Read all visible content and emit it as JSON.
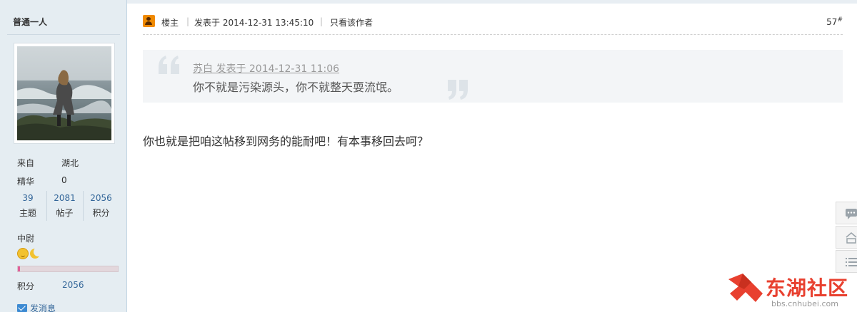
{
  "user": {
    "username": "普通一人",
    "from_label": "来自",
    "from_value": "湖北",
    "essence_label": "精华",
    "essence_value": "0",
    "stats": [
      {
        "value": "39",
        "label": "主题"
      },
      {
        "value": "2081",
        "label": "帖子"
      },
      {
        "value": "2056",
        "label": "积分"
      }
    ],
    "rank": "中尉",
    "medal_icons": [
      "sun-face-icon",
      "crescent-moon-icon"
    ],
    "level_progress_fraction": 0.02,
    "score_label": "积分",
    "score_value": "2056",
    "send_message_label": "发消息"
  },
  "post": {
    "owner_label": "楼主",
    "separator": "|",
    "date": "发表于 2014-12-31 13:45:10",
    "only_author_label": "只看该作者",
    "floor_number": "57",
    "floor_suffix": "#",
    "quote": {
      "meta": "苏白 发表于 2014-12-31 11:06",
      "text": "你不就是污染源头，你不就整天耍流氓。"
    },
    "body": "你也就是把咱这帖移到网务的能耐吧！有本事移回去呵？"
  },
  "side_tools": [
    "comment-icon",
    "back-to-top-icon",
    "list-icon"
  ],
  "watermark": {
    "title": "东湖社区",
    "url": "bbs.cnhubei.com"
  },
  "colors": {
    "sidebar_bg": "#e5edf2",
    "link_blue": "#336699",
    "watermark_red": "#e8402f",
    "progress_fill": "#e0609a"
  }
}
